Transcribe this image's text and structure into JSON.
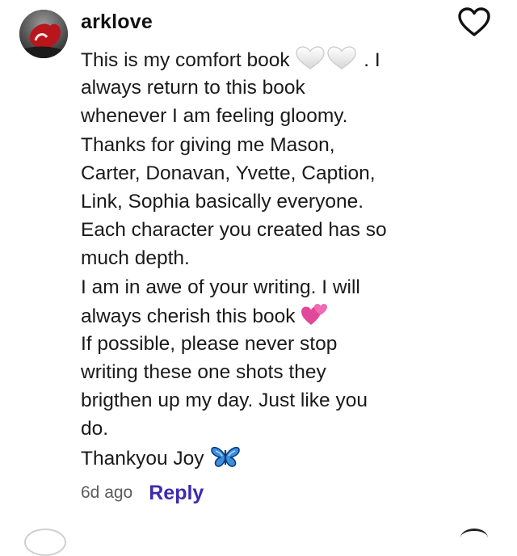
{
  "comment": {
    "username": "arklove",
    "lines": [
      {
        "text": "This is my comfort book ",
        "emoji": "white-heart-pair",
        "after": " . I"
      },
      {
        "text": "always return to this book"
      },
      {
        "text": "whenever I am feeling gloomy."
      },
      {
        "text": "Thanks for giving me Mason,"
      },
      {
        "text": "Carter, Donavan, Yvette, Caption,"
      },
      {
        "text": "Link, Sophia basically everyone."
      },
      {
        "text": "Each character you created has so"
      },
      {
        "text": "much depth."
      },
      {
        "text": "I am in awe of your writing. I will"
      },
      {
        "text": "always cherish this book ",
        "emoji": "two-hearts"
      },
      {
        "text": "If possible, please never stop"
      },
      {
        "text": "writing these one shots they"
      },
      {
        "text": "brigthen up my day. Just like you"
      },
      {
        "text": "do."
      },
      {
        "text": "Thankyou Joy ",
        "emoji": "butterfly"
      }
    ],
    "timestamp": "6d ago",
    "reply_label": "Reply"
  },
  "icons": {
    "like": "heart-outline-icon",
    "emoji_1": "white-heart-icon",
    "emoji_2": "two-hearts-icon",
    "emoji_3": "butterfly-icon"
  },
  "colors": {
    "reply": "#3d2bb0",
    "timestamp": "#5c5c5c",
    "text": "#1a1a1a",
    "pink_heart": "#e0489a",
    "butterfly": "#3b8fe0"
  }
}
